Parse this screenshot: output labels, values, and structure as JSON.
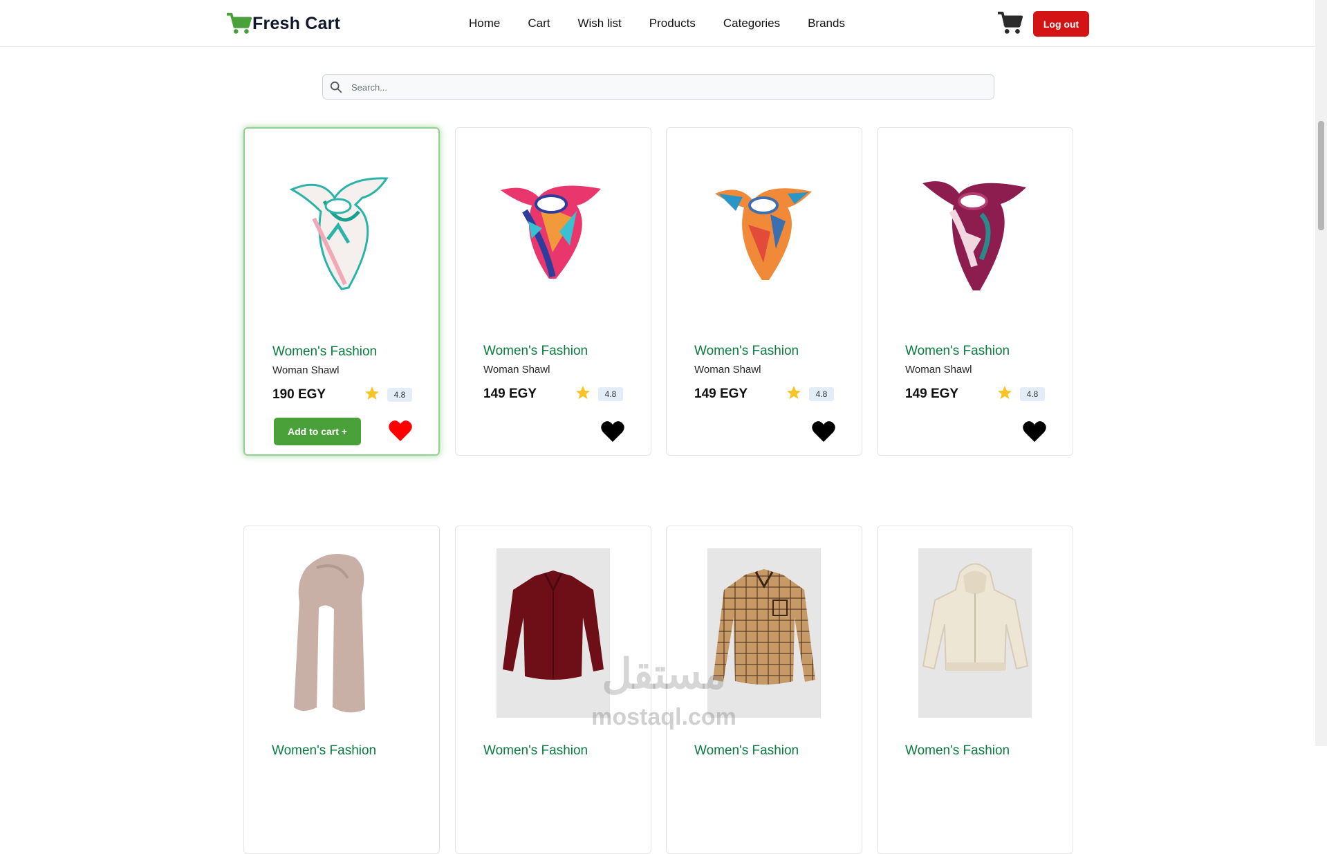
{
  "navbar": {
    "brand": "Fresh Cart",
    "links": [
      "Home",
      "Cart",
      "Wish list",
      "Products",
      "Categories",
      "Brands"
    ],
    "logout_label": "Log out"
  },
  "search": {
    "placeholder": "Search..."
  },
  "products_row1": [
    {
      "category": "Women's Fashion",
      "name": "Woman Shawl",
      "price": "190 EGY",
      "rating": "4.8",
      "add_label": "Add to cart +",
      "wishlisted": true,
      "colors": [
        "#2bb3a8",
        "#f2a8b5",
        "#f5f0ee",
        "#1aa08c"
      ]
    },
    {
      "category": "Women's Fashion",
      "name": "Woman Shawl",
      "price": "149 EGY",
      "rating": "4.8",
      "wishlisted": false,
      "colors": [
        "#e9376e",
        "#2e3d9c",
        "#f09a3c",
        "#3bbfd2"
      ]
    },
    {
      "category": "Women's Fashion",
      "name": "Woman Shawl",
      "price": "149 EGY",
      "rating": "4.8",
      "wishlisted": false,
      "colors": [
        "#f08a38",
        "#2a95c7",
        "#e24a3a",
        "#3b6fb0"
      ]
    },
    {
      "category": "Women's Fashion",
      "name": "Woman Shawl",
      "price": "149 EGY",
      "rating": "4.8",
      "wishlisted": false,
      "colors": [
        "#8c1d4e",
        "#f3d7e0",
        "#2a8a8a",
        "#b43a6e"
      ]
    }
  ],
  "products_row2": [
    {
      "category": "Women's Fashion",
      "item": "scarf",
      "color": "#c8b0a6"
    },
    {
      "category": "Women's Fashion",
      "item": "shirt",
      "color": "#6e0f18"
    },
    {
      "category": "Women's Fashion",
      "item": "plaid-shirt",
      "color": "#c69a66"
    },
    {
      "category": "Women's Fashion",
      "item": "hoodie",
      "color": "#eee6d4"
    }
  ],
  "watermark": {
    "arabic": "مستقل",
    "latin": "mostaql.com"
  },
  "colors": {
    "brand_green": "#4aa13a",
    "category_green": "#0a7a3f",
    "logout_red": "#d41414",
    "heart_red": "#ff0000",
    "star_yellow": "#f7c325"
  }
}
